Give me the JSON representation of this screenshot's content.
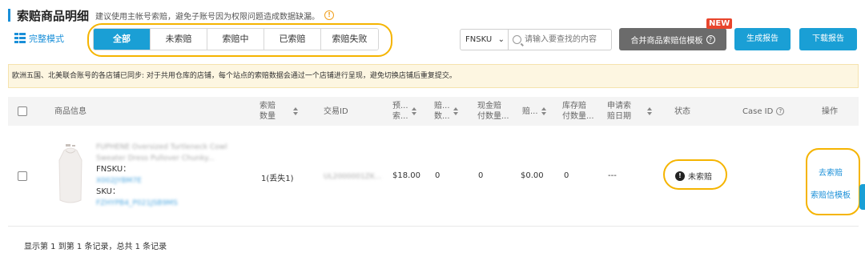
{
  "header": {
    "title": "索赔商品明细",
    "hint": "建议使用主帐号索赔，避免子账号因为权限问题造成数据缺漏。",
    "warn_icon": "!"
  },
  "view_mode": {
    "label": "完整模式"
  },
  "tabs": [
    {
      "label": "全部",
      "active": true
    },
    {
      "label": "未索赔",
      "active": false
    },
    {
      "label": "索赔中",
      "active": false
    },
    {
      "label": "已索赔",
      "active": false
    },
    {
      "label": "索赔失败",
      "active": false
    }
  ],
  "search": {
    "select_value": "FNSKU",
    "placeholder": "请输入要查找的内容"
  },
  "toolbar": {
    "merge_label": "合并商品索赔信模板",
    "merge_help": "?",
    "new_badge": "NEW",
    "generate_label": "生成报告",
    "download_label": "下载报告"
  },
  "notice": "欧洲五国、北美联合账号的各店铺已同步: 对于共用仓库的店铺，每个站点的索赔数据会通过一个店铺进行呈现，避免切换店铺后重复提交。",
  "table": {
    "headers": {
      "product": "商品信息",
      "claim_qty_1": "索赔",
      "claim_qty_2": "数量",
      "txn_id": "交易ID",
      "est_1": "预...",
      "est_2": "索...",
      "claim_1": "赔...",
      "claim_2": "数...",
      "cash_1": "现金赔",
      "cash_2": "付数量...",
      "amt": "赔...",
      "inv_1": "库存赔",
      "inv_2": "付数量...",
      "apply_1": "申请索",
      "apply_2": "赔日期",
      "status": "状态",
      "case_id": "Case ID",
      "actions": "操作"
    },
    "rows": [
      {
        "title_line1": "FUPHENE Oversized Turtleneck Cowl",
        "title_line2": "Sweater Dress Pullover Chunky...",
        "fnsku_label": "FNSKU：",
        "fnsku_value": "X002JYBM7E",
        "sku_label": "SKU：",
        "sku_value": "FZHYPB4_P021JSB9MS",
        "claim_qty": "1(丢失1)",
        "txn_id": "UL2000001ZK...",
        "est_amount": "$18.00",
        "claim_count": "0",
        "cash_qty": "0",
        "amount": "$0.00",
        "inv_qty": "0",
        "apply_date": "---",
        "status": "未索赔",
        "status_icon": "!",
        "case_id": "",
        "action_claim": "去索赔",
        "action_template": "索赔信模板"
      }
    ]
  },
  "footer": "显示第 1 到第 1 条记录，总共 1 条记录",
  "colors": {
    "primary": "#1a9fd5",
    "highlight": "#f5b400",
    "new_badge": "#e8452c",
    "notice_bg": "#fdf6e1"
  }
}
